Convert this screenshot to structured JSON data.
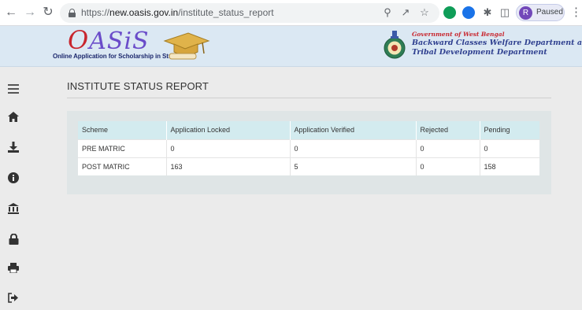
{
  "browser": {
    "url_scheme": "https://",
    "url_host": "new.oasis.gov.in",
    "url_path": "/institute_status_report",
    "profile_initial": "R",
    "profile_status": "Paused",
    "icons": [
      "back-arrow-icon",
      "forward-arrow-icon",
      "reload-icon",
      "lock-icon",
      "zoom-icon",
      "share-icon",
      "bookmark-star-icon",
      "extension-icon",
      "extension-icon",
      "puzzle-icon",
      "sidepanel-icon",
      "kebab-menu-icon"
    ]
  },
  "header": {
    "logo_first_letter": "O",
    "logo_rest": "ASiS",
    "logo_tagline": "Online Application for Scholarship in Studies",
    "gov_line": "Government of West Bengal",
    "dept_line1": "Backward Classes Welfare Department and",
    "dept_line2": "Tribal Development Department"
  },
  "sidebar": {
    "icons": [
      "menu-icon",
      "home-icon",
      "download-icon",
      "info-icon",
      "bank-icon",
      "lock-icon",
      "print-icon",
      "logout-icon"
    ]
  },
  "main": {
    "title": "INSTITUTE STATUS REPORT",
    "table": {
      "columns": [
        "Scheme",
        "Application Locked",
        "Application Verified",
        "Rejected",
        "Pending"
      ],
      "rows": [
        [
          "PRE MATRIC",
          "0",
          "0",
          "0",
          "0"
        ],
        [
          "POST MATRIC",
          "163",
          "5",
          "0",
          "158"
        ]
      ]
    }
  },
  "colors": {
    "header_bg": "#dbe8f3",
    "table_header_bg": "#d3ebef",
    "panel_bg": "#dfe5e6",
    "brand_red": "#c8262e",
    "brand_blue": "#2e3f8f"
  }
}
